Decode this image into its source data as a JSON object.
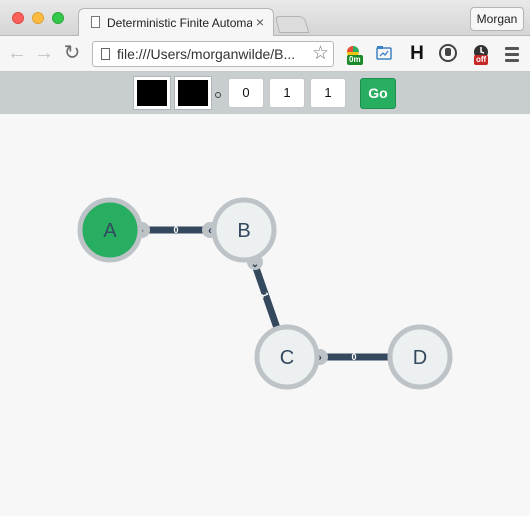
{
  "window": {
    "tab_title": "Deterministic Finite Automaton",
    "tab_close": "×",
    "profile_name": "Morgan"
  },
  "toolbar": {
    "url": "file:///Users/morganwilde/B...",
    "back_icon": "back-arrow-icon",
    "forward_icon": "forward-arrow-icon",
    "reload_icon": "reload-icon",
    "star_icon": "bookmark-star-icon",
    "ext_badge_1": "0m",
    "ext_badge_2": "off"
  },
  "controls": {
    "color_1": "#000000",
    "color_2": "#000000",
    "value_1": "0",
    "value_2": "1",
    "value_3": "1",
    "go_label": "Go",
    "go_color": "#27ae60"
  },
  "graph": {
    "states": [
      {
        "id": "A",
        "label": "A",
        "active": true
      },
      {
        "id": "B",
        "label": "B",
        "active": false
      },
      {
        "id": "C",
        "label": "C",
        "active": false
      },
      {
        "id": "D",
        "label": "D",
        "active": false
      }
    ],
    "transitions": [
      {
        "from": "A",
        "to": "B",
        "symbol": "0"
      },
      {
        "from": "B",
        "to": "C",
        "symbol": "1"
      },
      {
        "from": "C",
        "to": "D",
        "symbol": "0"
      }
    ],
    "colors": {
      "active_fill": "#27ae60",
      "state_fill": "#ecf0f1",
      "state_border": "#bdc3c7",
      "edge": "#34495e",
      "label": "#34495e"
    }
  }
}
